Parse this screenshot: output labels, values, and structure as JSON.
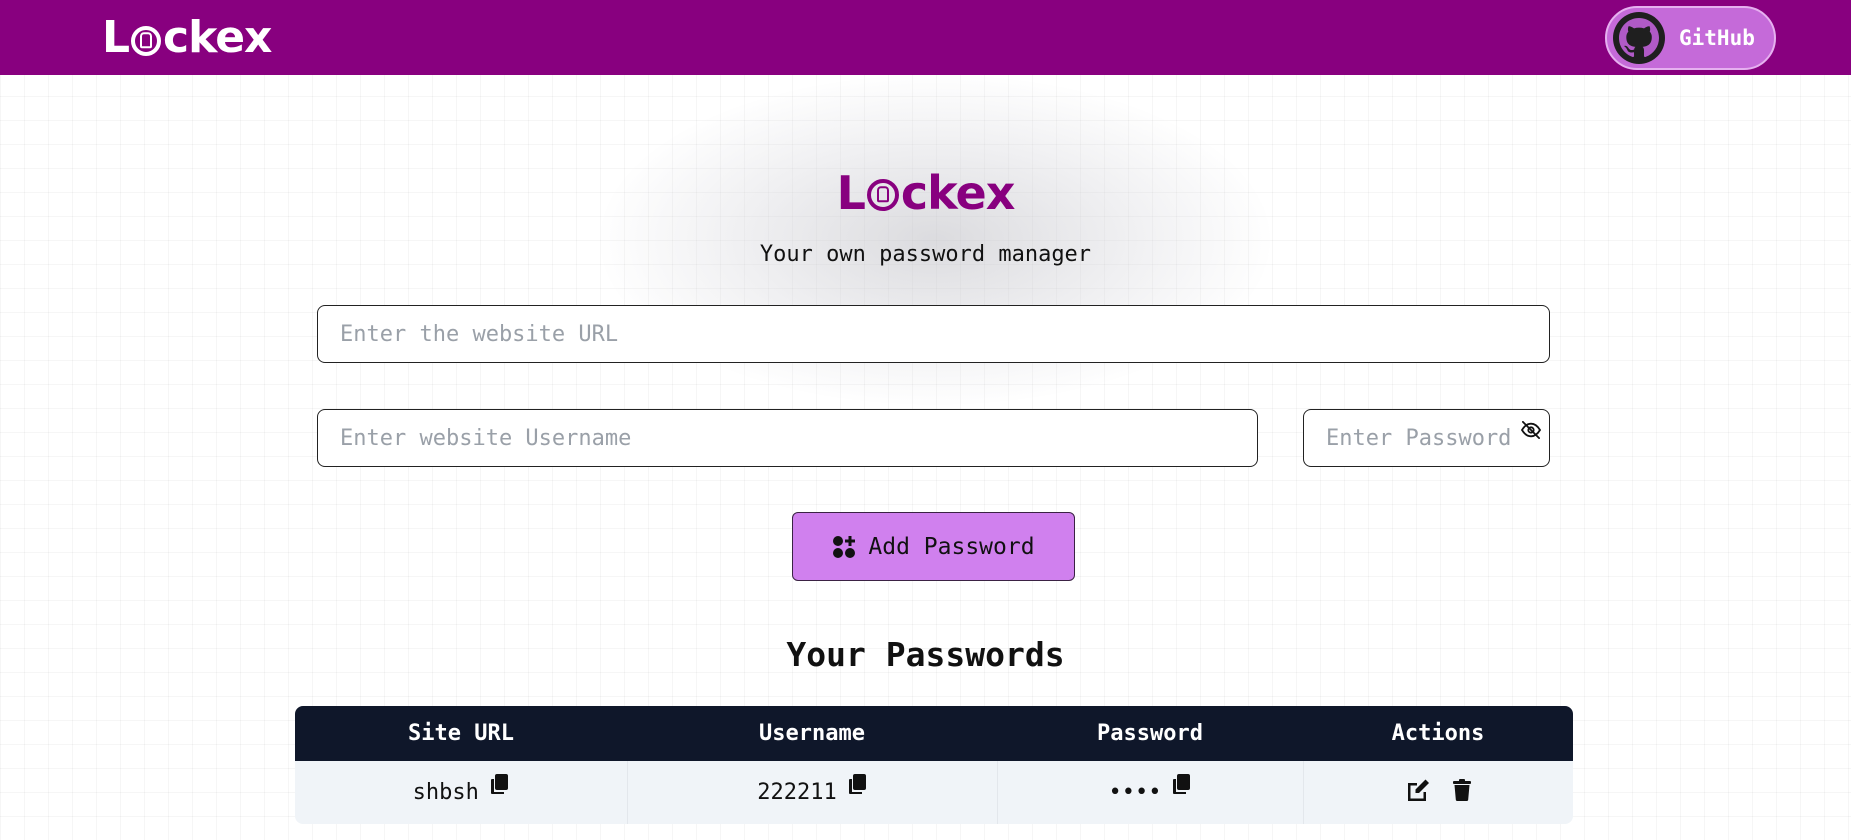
{
  "colors": {
    "brand_purple": "#88007f",
    "button_purple": "#d080ee",
    "table_header": "#0f172a",
    "row_bg": "#f0f4f8"
  },
  "navbar": {
    "brand_prefix": "L",
    "brand_suffix": "ckex",
    "github_label": "GitHub",
    "github_icon": "github-icon"
  },
  "hero": {
    "title_prefix": "L",
    "title_suffix": "ckex",
    "subtitle": "Your own password manager"
  },
  "form": {
    "url_placeholder": "Enter the website URL",
    "username_placeholder": "Enter website Username",
    "password_placeholder": "Enter Password",
    "add_button_label": "Add Password",
    "add_button_icon": "add-password-icon",
    "toggle_visibility_icon": "eye-slash-icon"
  },
  "passwords": {
    "section_title": "Your Passwords",
    "columns": [
      "Site URL",
      "Username",
      "Password",
      "Actions"
    ],
    "rows": [
      {
        "site": "shbsh",
        "username": "222211",
        "password": "••••",
        "actions": [
          "edit-icon",
          "delete-icon"
        ]
      }
    ]
  }
}
